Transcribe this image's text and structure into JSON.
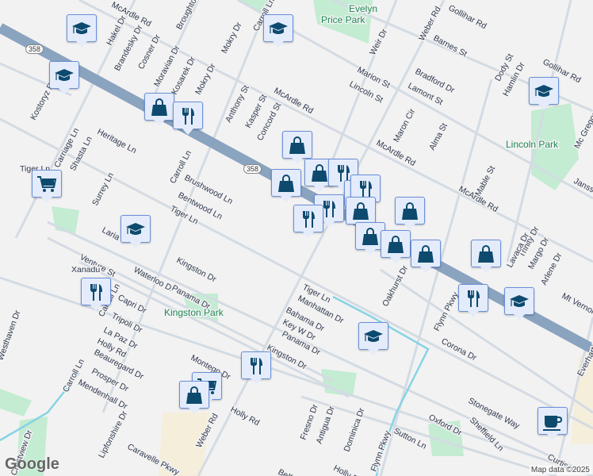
{
  "map": {
    "highway_shield": "358",
    "parks": [
      "Evelyn Price Park",
      "Lincoln Park",
      "Kingston Park"
    ],
    "streets": [
      "McArdle Rd",
      "Hakel Dr",
      "Brandesky Dr",
      "Cosner Dr",
      "Broughton",
      "Moravian Dr",
      "Kosarek Dr",
      "Mokry Dr",
      "Mokry Dr",
      "Carroll Ln",
      "Kostoryz Rd",
      "Anthony St",
      "Kasper St",
      "Concord St",
      "McArdle Rd",
      "Heritage Ln",
      "Carriage Ln",
      "Shasta Ln",
      "Surrey Ln",
      "Tiger Ln",
      "Carroll Ln",
      "Brushwood Ln",
      "Bentwood Ln",
      "Tiger Ln",
      "Laria",
      "Weber Rd",
      "Gollihar Rd",
      "Barnes St",
      "Weir Dr",
      "Marion St",
      "Lincoln St",
      "Bradford Dr",
      "Lamont St",
      "Dody St",
      "Hamlin Dr",
      "Gollihar Rd",
      "Mc Gregor Dr",
      "Maron Cir",
      "Alma St",
      "McArdle Rd",
      "McArdle Rd",
      "Mable St",
      "Janss",
      "Venture St",
      "Waterloo Dr",
      "Kingston Dr",
      "Panama Dr",
      "Carroll Ln",
      "Xanadu",
      "Capri Dr",
      "Tripoli Dr",
      "La Paz Dr",
      "Holly Rd",
      "Beauregard Dr",
      "Prosper Dr",
      "Mendenhall Dr",
      "Carroll Ln",
      "Lipfonshire Dr",
      "Caravelle Pkwy",
      "Weber Rd",
      "Holly Rd",
      "Montego Dr",
      "Bahama Dr",
      "Key W Dr",
      "Panama Dr",
      "Kingston Dr",
      "Tiger Ln",
      "Manhattan Dr",
      "Oakhurst Dr",
      "Flynn Pkwy",
      "Corona Dr",
      "Stonegate Way",
      "Oxford Dr",
      "Sheffield Ln",
      "Sutton Ln",
      "Fresno Dr",
      "Antigua Dr",
      "Dominica Dr",
      "Flynn Pkwy",
      "Trinity Dr",
      "Lavaca Dr",
      "Margo Dr",
      "Arlene Dr",
      "Mt Vernon",
      "Everhart Rd",
      "Curtis",
      "Holly Rd",
      "Belfast",
      "Westhaven Dr",
      "Crestview Dr"
    ],
    "markers": [
      "school-icon",
      "school-icon",
      "school-icon",
      "school-icon",
      "school-icon",
      "school-icon",
      "school-icon",
      "shopping-bag-icon",
      "restaurant-icon",
      "shopping-cart-icon",
      "restaurant-icon",
      "shopping-bag-icon",
      "shopping-bag-icon",
      "shopping-bag-icon",
      "restaurant-icon",
      "shopping-bag-icon",
      "restaurant-icon",
      "restaurant-icon",
      "shopping-bag-icon",
      "shopping-bag-icon",
      "restaurant-icon",
      "shopping-bag-icon",
      "shopping-bag-icon",
      "shopping-bag-icon",
      "restaurant-icon",
      "shopping-bag-icon",
      "restaurant-icon",
      "shopping-cart-icon",
      "shopping-bag-icon",
      "coffee-cup-icon"
    ]
  },
  "branding": {
    "logo": "Google",
    "attribution": "Map data ©2025"
  },
  "colors": {
    "highway": "#8aa3bf",
    "road": "#d3dbe3",
    "park": "#c3ecd2",
    "marker_bg": "#e4ecfb",
    "icon": "#0d4a6e"
  }
}
